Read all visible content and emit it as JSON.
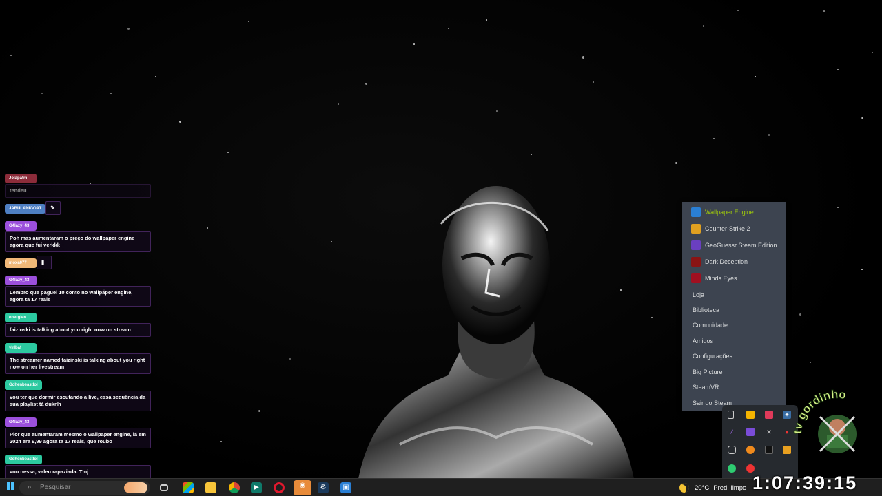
{
  "chat": [
    {
      "user": "Jolapatm",
      "color": "#8c2c3a",
      "text": "tendeu",
      "faded": true
    },
    {
      "user": "JABULANIGOAT",
      "color": "#4e7fc2",
      "text": "✎",
      "faded": false
    },
    {
      "user": "G4lazy_43",
      "color": "#9b4fdc",
      "text": "Poh mas aumentaram o preço do wallpaper engine agora que fui verkkk",
      "faded": false
    },
    {
      "user": "moxa077",
      "color": "#f0b878",
      "text": "▮",
      "faded": false
    },
    {
      "user": "G4lazy_43",
      "color": "#9b4fdc",
      "text": "Lembro que paguei 10 conto no wallpaper engine, agora ta 17 reals",
      "faded": false
    },
    {
      "user": "energlen",
      "color": "#2cc9a0",
      "text": "faizinski is talking about you right now on stream",
      "faded": false
    },
    {
      "user": "vlrlbaf",
      "color": "#2cc9a0",
      "text": "The streamer named faizinski is talking about you right now on her livestream",
      "faded": false
    },
    {
      "user": "Gohenbeastlol",
      "color": "#2cc9a0",
      "text": "vou ter que dormir escutando a live, essa sequência da sua playlist tá dukrlh",
      "faded": false
    },
    {
      "user": "G4lazy_43",
      "color": "#9b4fdc",
      "text": "Pior que aumentaram mesmo o wallpaper engine, lá em 2024 era 9,99 agora ta 17 reais, que roubo",
      "faded": false
    },
    {
      "user": "Gohenbeastlol",
      "color": "#2cc9a0",
      "text": "vou nessa, valeu rapaziada. Tmj",
      "faded": false
    }
  ],
  "steam_menu": {
    "games": [
      {
        "label": "Wallpaper Engine",
        "icon": "wallpaper-engine-icon",
        "color": "#2a7fd4",
        "highlight": true
      },
      {
        "label": "Counter-Strike 2",
        "icon": "counter-strike-icon",
        "color": "#e0a020",
        "highlight": false
      },
      {
        "label": "GeoGuessr Steam Edition",
        "icon": "geoguessr-icon",
        "color": "#6a3fc0",
        "highlight": false
      },
      {
        "label": "Dark Deception",
        "icon": "dark-deception-icon",
        "color": "#8a1414",
        "highlight": false
      },
      {
        "label": "Minds Eyes",
        "icon": "minds-eyes-icon",
        "color": "#a01020",
        "highlight": false
      }
    ],
    "group1": [
      "Loja",
      "Biblioteca",
      "Comunidade"
    ],
    "group2": [
      "Amigos",
      "Configurações"
    ],
    "group3": [
      "Big Picture",
      "SteamVR"
    ],
    "group4": [
      "Sair do Steam"
    ]
  },
  "taskbar": {
    "search_placeholder": "Pesquisar",
    "weather_temp": "20°C",
    "weather_desc": "Pred. limpo"
  },
  "overlay": {
    "clock": "1:07:39:15",
    "watermark": "tv gordinho"
  },
  "colors": {
    "menu_bg": "#3d4450",
    "menu_highlight": "#a4d007",
    "taskbar_bg": "#1f1f1f"
  }
}
